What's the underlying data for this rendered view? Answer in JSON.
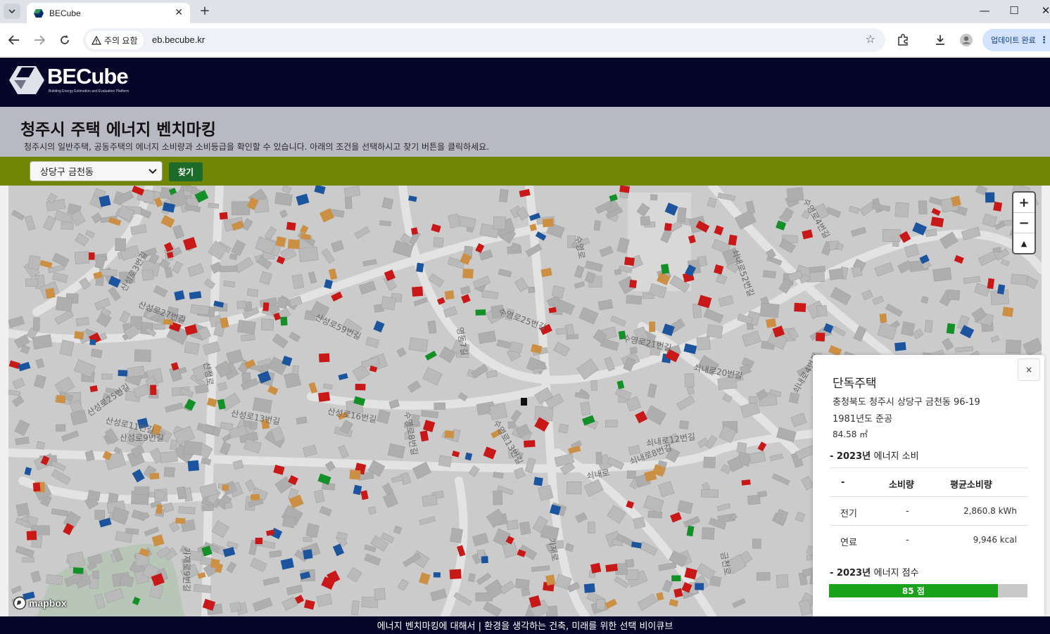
{
  "browser": {
    "tab_title": "BECube",
    "security_label": "주의 요함",
    "url": "eb.becube.kr",
    "update_label": "업데이트 완료"
  },
  "site": {
    "logo_text": "BECube",
    "logo_tagline": "Building Energy Estimation and Evaluation Platform",
    "page_title": "청주시 주택 에너지 벤치마킹",
    "page_description": "청주시의 일반주택, 공동주택의 에너지 소비량과 소비등급을 확인할 수 있습니다. 아래의 조건을 선택하시고 찾기 버튼을 클릭하세요.",
    "region_selected": "상당구 금천동",
    "find_label": "찾기",
    "footer_text": "에너지 벤치마킹에 대해서  | 환경을 생각하는 건축, 미래를 위한 선택 비이큐브"
  },
  "map": {
    "attribution": "mapbox",
    "zoom_in": "+",
    "zoom_out": "−",
    "compass": "▲",
    "labels": [
      "산성로27번길",
      "산성로25번길",
      "산성로11번길",
      "산성로9번길",
      "산성로16번길",
      "산성로59번길",
      "수영로25번길",
      "수영로21번길",
      "수영로",
      "산성로13번길",
      "수영로13번길",
      "가재로9번길",
      "산성로3번길",
      "쇠내로",
      "쇠내로8번길",
      "쇠내로52번길",
      "산성로",
      "수영로4번길",
      "가재로",
      "금천로",
      "수영로8번길",
      "쇠내로12번길",
      "쇠내로20번길",
      "영동7길",
      "쇠내로4번길"
    ]
  },
  "popup": {
    "close": "×",
    "building_type": "단독주택",
    "address": "충청북도 청주시 상당구 금천동 96-19",
    "built_year": "1981년도 준공",
    "area": "84.58 ㎡",
    "consumption_year": "2023년",
    "consumption_title": "에너지 소비",
    "table": {
      "headers": [
        "-",
        "소비량",
        "평균소비량"
      ],
      "rows": [
        {
          "label": "전기",
          "value": "-",
          "average": "2,860.8 kWh"
        },
        {
          "label": "연료",
          "value": "-",
          "average": "9,946 kcal"
        }
      ]
    },
    "score_year": "2023년",
    "score_title": "에너지 점수",
    "score_label": "85 점",
    "score_fraction": 0.85,
    "score_color": "#1aa31a"
  },
  "colors": {
    "header_bg": "#050628",
    "filter_bg": "#728605",
    "building_red": "#d61a1a",
    "building_blue": "#1f5aa8",
    "building_green": "#169a2b",
    "building_orange": "#d99a4a",
    "building_black": "#111111"
  }
}
